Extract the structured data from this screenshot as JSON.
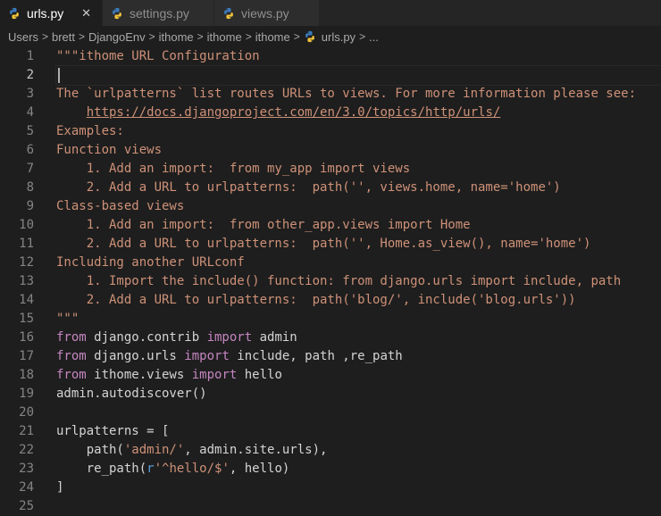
{
  "tabs": [
    {
      "label": "urls.py",
      "active": true,
      "close": "✕"
    },
    {
      "label": "settings.py",
      "active": false
    },
    {
      "label": "views.py",
      "active": false
    }
  ],
  "breadcrumb": {
    "items": [
      "Users",
      "brett",
      "DjangoEnv",
      "ithome",
      "ithome",
      "ithome"
    ],
    "file": "urls.py",
    "tail": "...",
    "sep": ">"
  },
  "editor": {
    "current_line": 2,
    "lines": [
      [
        {
          "t": "\"\"\"ithome URL Configuration",
          "c": "str"
        }
      ],
      [],
      [
        {
          "t": "The `urlpatterns` list routes URLs to views. For more information please see:",
          "c": "str"
        }
      ],
      [
        {
          "t": "    ",
          "c": "str"
        },
        {
          "t": "https://docs.djangoproject.com/en/3.0/topics/http/urls/",
          "c": "link"
        }
      ],
      [
        {
          "t": "Examples:",
          "c": "str"
        }
      ],
      [
        {
          "t": "Function views",
          "c": "str"
        }
      ],
      [
        {
          "t": "    1. Add an import:  from my_app import views",
          "c": "str"
        }
      ],
      [
        {
          "t": "    2. Add a URL to urlpatterns:  path('', views.home, name='home')",
          "c": "str"
        }
      ],
      [
        {
          "t": "Class-based views",
          "c": "str"
        }
      ],
      [
        {
          "t": "    1. Add an import:  from other_app.views import Home",
          "c": "str"
        }
      ],
      [
        {
          "t": "    2. Add a URL to urlpatterns:  path('', Home.as_view(), name='home')",
          "c": "str"
        }
      ],
      [
        {
          "t": "Including another URLconf",
          "c": "str"
        }
      ],
      [
        {
          "t": "    1. Import the include() function: from django.urls import include, path",
          "c": "str"
        }
      ],
      [
        {
          "t": "    2. Add a URL to urlpatterns:  path('blog/', include('blog.urls'))",
          "c": "str"
        }
      ],
      [
        {
          "t": "\"\"\"",
          "c": "str"
        }
      ],
      [
        {
          "t": "from",
          "c": "kw"
        },
        {
          "t": " django.contrib ",
          "c": "code"
        },
        {
          "t": "import",
          "c": "kw"
        },
        {
          "t": " admin",
          "c": "code"
        }
      ],
      [
        {
          "t": "from",
          "c": "kw"
        },
        {
          "t": " django.urls ",
          "c": "code"
        },
        {
          "t": "import",
          "c": "kw"
        },
        {
          "t": " include, path ,re_path",
          "c": "code"
        }
      ],
      [
        {
          "t": "from",
          "c": "kw"
        },
        {
          "t": " ithome.views ",
          "c": "code"
        },
        {
          "t": "import",
          "c": "kw"
        },
        {
          "t": " hello",
          "c": "code"
        }
      ],
      [
        {
          "t": "admin.autodiscover()",
          "c": "code"
        }
      ],
      [],
      [
        {
          "t": "urlpatterns = [",
          "c": "code"
        }
      ],
      [
        {
          "t": "    path(",
          "c": "code"
        },
        {
          "t": "'admin/'",
          "c": "str"
        },
        {
          "t": ", admin.site.urls),",
          "c": "code"
        }
      ],
      [
        {
          "t": "    re_path(",
          "c": "code"
        },
        {
          "t": "r",
          "c": "pfx"
        },
        {
          "t": "'^hello/$'",
          "c": "str"
        },
        {
          "t": ", hello)",
          "c": "code"
        }
      ],
      [
        {
          "t": "]",
          "c": "code"
        }
      ],
      []
    ]
  },
  "colors": {
    "background": "#1e1e1e",
    "string": "#ce9178",
    "keyword": "#c586c0",
    "prefix": "#569cd6",
    "text": "#d4d4d4",
    "line_number": "#858585"
  },
  "icons": {
    "file": "python-icon",
    "close": "close-icon"
  }
}
